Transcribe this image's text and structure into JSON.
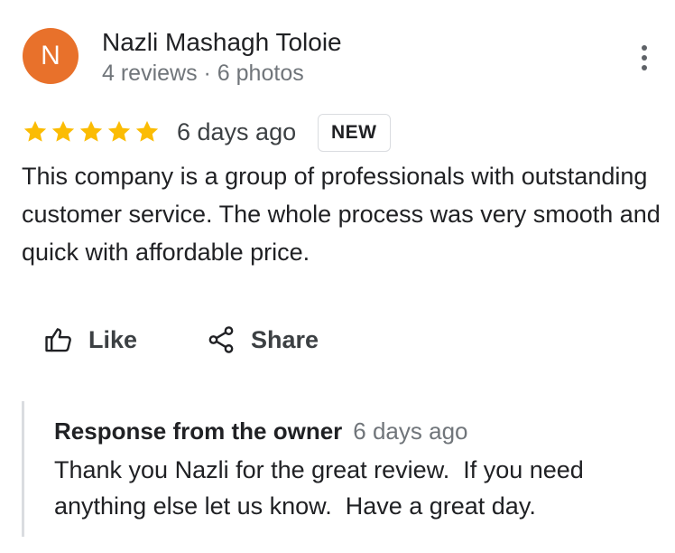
{
  "author": {
    "initial": "N",
    "name": "Nazli Mashagh Toloie",
    "meta": "4 reviews · 6 photos",
    "avatar_color": "#e8712b"
  },
  "menu": {
    "icon": "more-vert-icon"
  },
  "review": {
    "rating": 5,
    "max_rating": 5,
    "star_color": "#fbbc04",
    "time": "6 days ago",
    "badge": "NEW",
    "text": "This company is a group of professionals with outstanding customer service. The whole process was very smooth and quick with affordable price."
  },
  "actions": {
    "like": {
      "label": "Like",
      "icon": "thumbs-up-icon"
    },
    "share": {
      "label": "Share",
      "icon": "share-icon"
    }
  },
  "owner_response": {
    "title": "Response from the owner",
    "time": "6 days ago",
    "text": "Thank you Nazli for the great review.  If you need anything else let us know.  Have a great day."
  }
}
